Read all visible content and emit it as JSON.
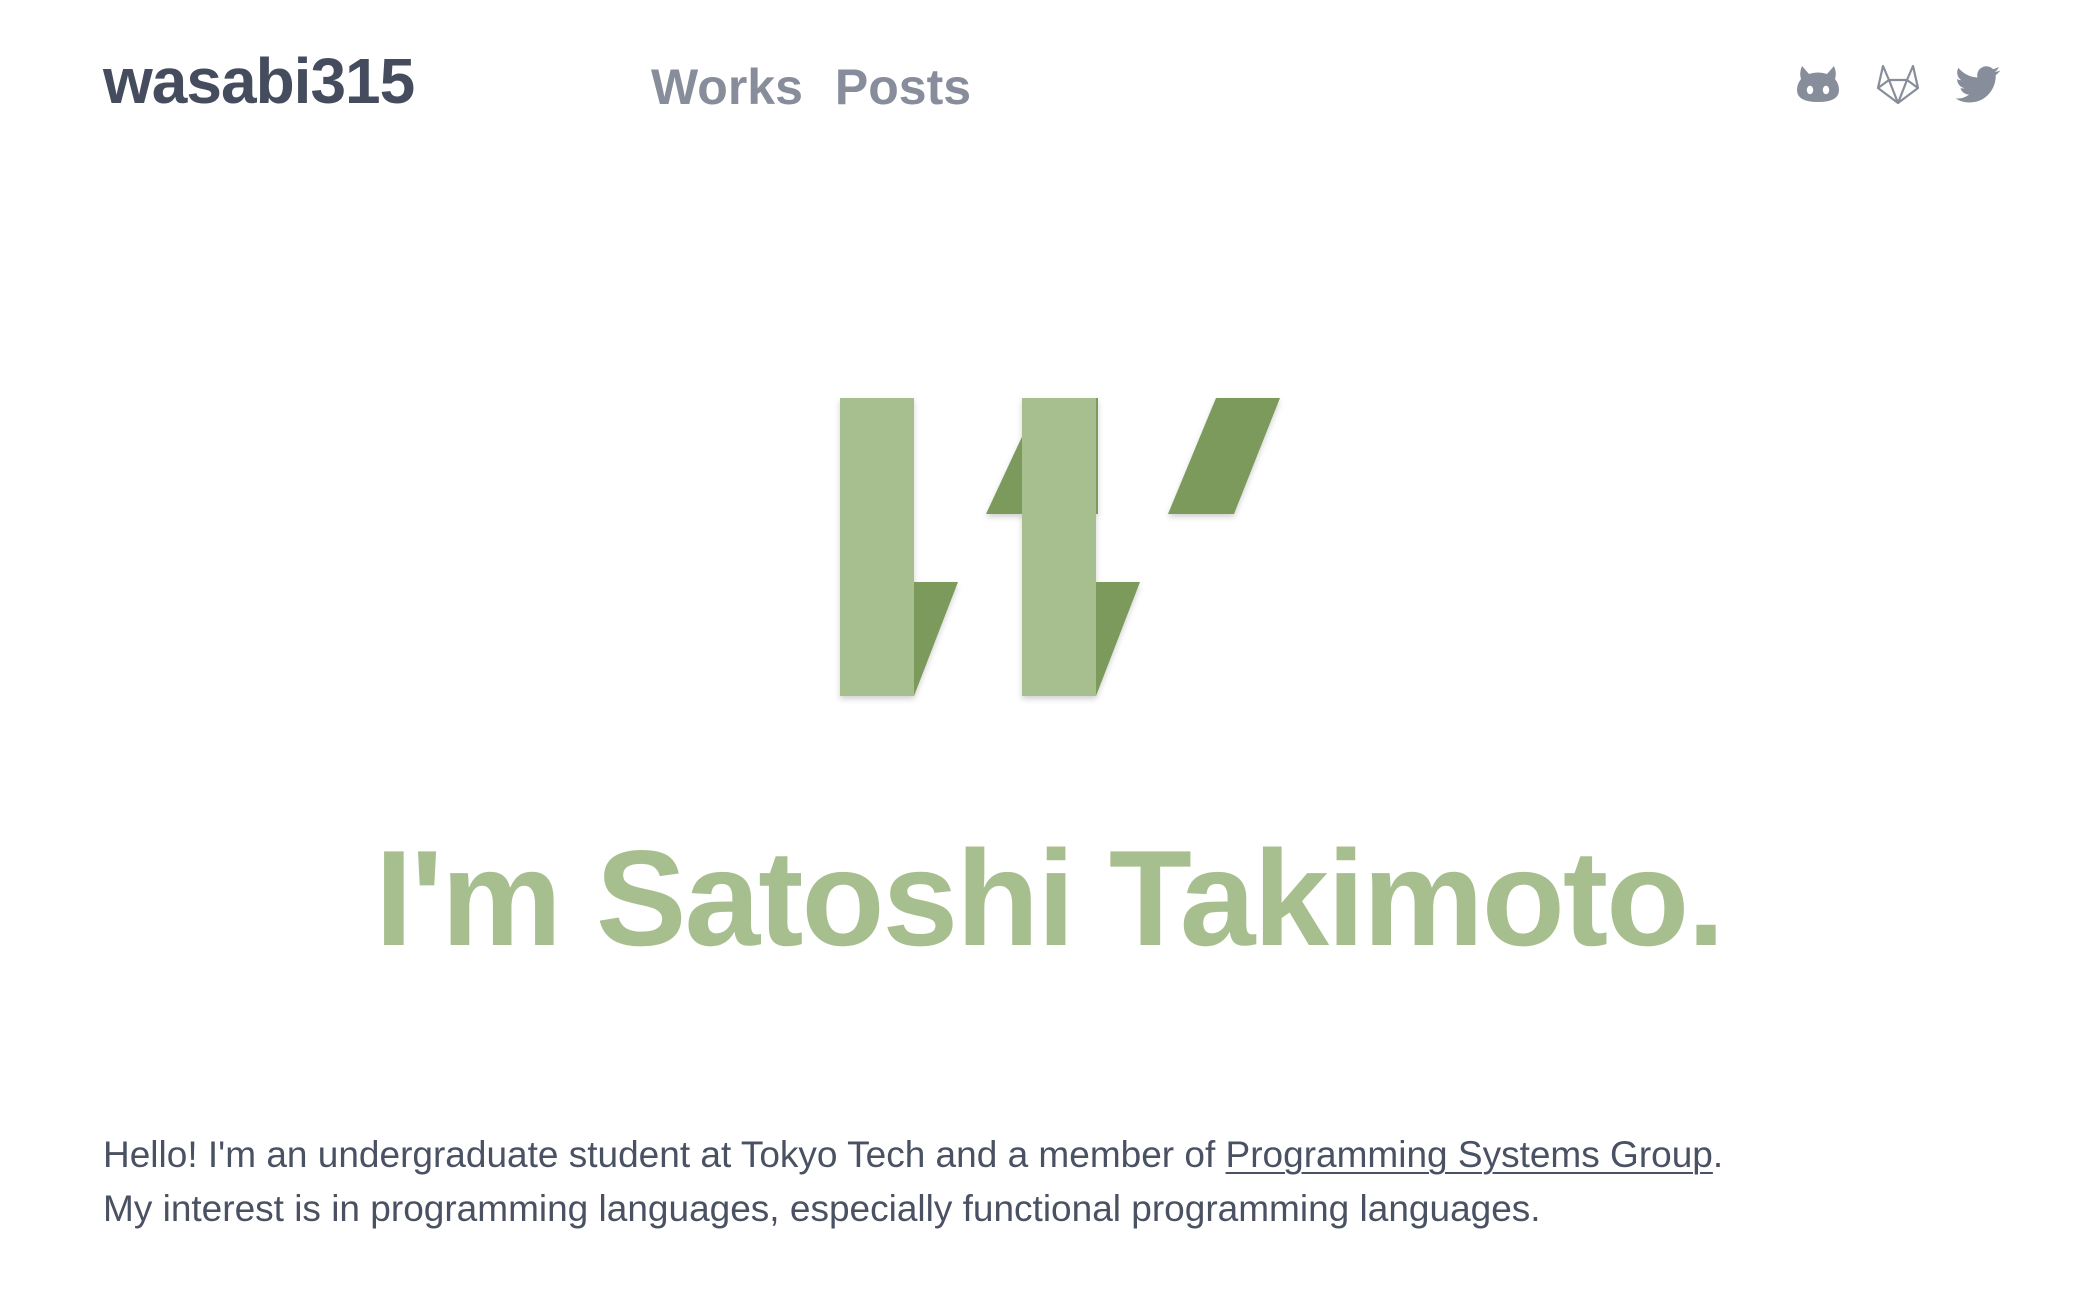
{
  "header": {
    "brand": "wasabi315",
    "nav": [
      {
        "label": "Works"
      },
      {
        "label": "Posts"
      }
    ],
    "social": [
      {
        "icon": "github-icon"
      },
      {
        "icon": "gitlab-icon"
      },
      {
        "icon": "twitter-icon"
      }
    ]
  },
  "hero": {
    "title": "I'm Satoshi Takimoto."
  },
  "bio": {
    "line1_before": "Hello! I'm an undergraduate student at Tokyo Tech and a member of ",
    "line1_link": "Programming Systems Group",
    "line1_after": ".",
    "line2": "My interest is in programming languages, especially functional programming languages."
  },
  "colors": {
    "accent_light": "#a7bf8f",
    "accent_dark": "#7b9a5c",
    "text": "#4a5162",
    "muted": "#878d9b"
  }
}
